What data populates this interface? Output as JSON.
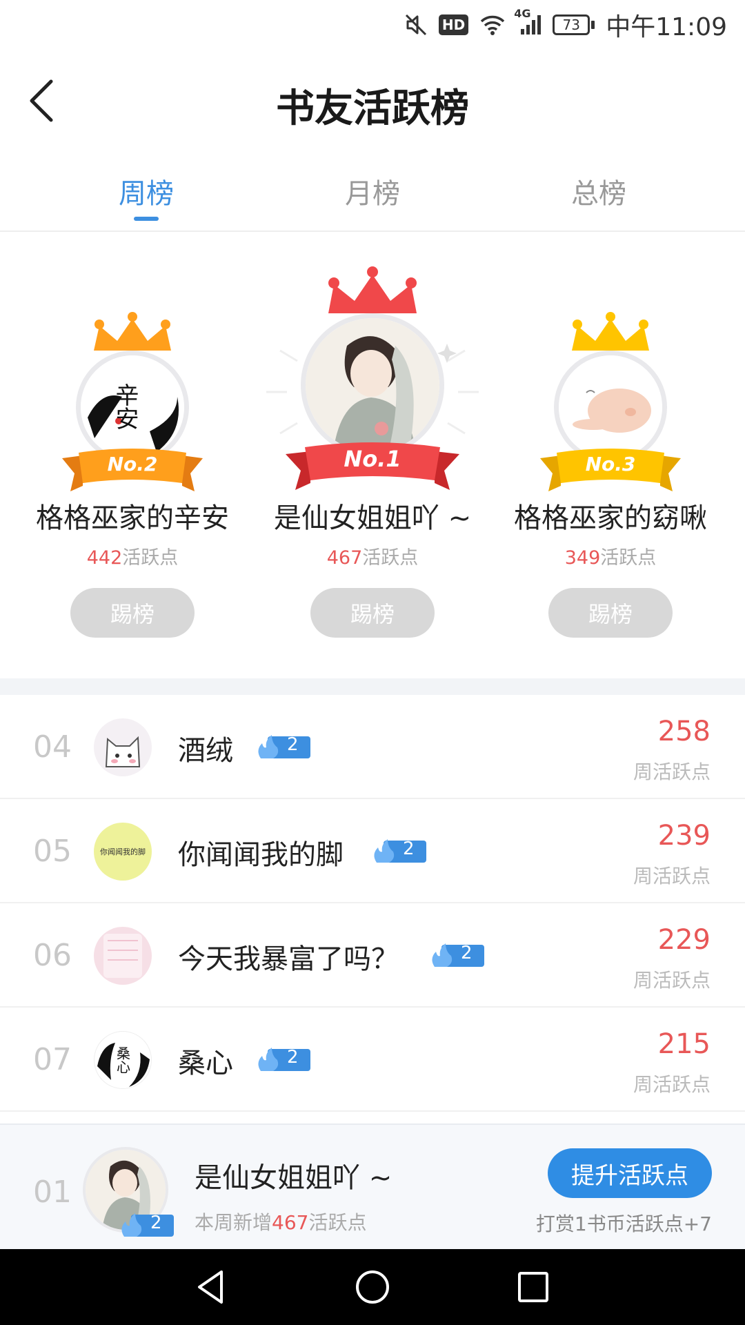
{
  "status_bar": {
    "time": "中午11:09",
    "battery": "73",
    "hd": "HD",
    "network": "4G"
  },
  "header": {
    "title": "书友活跃榜"
  },
  "tabs": [
    {
      "label": "周榜",
      "active": true
    },
    {
      "label": "月榜",
      "active": false
    },
    {
      "label": "总榜",
      "active": false
    }
  ],
  "podium": {
    "points_unit": "活跃点",
    "kick_label": "踢榜",
    "first": {
      "rank_label": "No.1",
      "name": "是仙女姐姐吖 ~",
      "points": "467",
      "avatar_text": ""
    },
    "second": {
      "rank_label": "No.2",
      "name": "格格巫家的辛安",
      "points": "442",
      "avatar_text": "辛安"
    },
    "third": {
      "rank_label": "No.3",
      "name": "格格巫家的窈啾",
      "points": "349",
      "avatar_text": ""
    }
  },
  "list": {
    "score_label": "周活跃点",
    "rows": [
      {
        "rank": "04",
        "name": "酒绒",
        "level": "2",
        "score": "258",
        "avatar_text": "",
        "avatar_color": "#f4f0f4"
      },
      {
        "rank": "05",
        "name": "你闻闻我的脚",
        "level": "2",
        "score": "239",
        "avatar_text": "你闻闻我的脚",
        "avatar_color": "#eef29a"
      },
      {
        "rank": "06",
        "name": "今天我暴富了吗？",
        "level": "2",
        "score": "229",
        "avatar_text": "",
        "avatar_color": "#f6dfe6"
      },
      {
        "rank": "07",
        "name": "桑心",
        "level": "2",
        "score": "215",
        "avatar_text": "桑心",
        "avatar_color": "#ffffff"
      }
    ]
  },
  "my_rank": {
    "rank": "01",
    "name": "是仙女姐姐吖 ~",
    "level": "2",
    "sub_prefix": "本周新增",
    "sub_points": "467",
    "sub_suffix": "活跃点",
    "boost_label": "提升活跃点",
    "boost_note": "打赏1书币活跃点+7"
  },
  "colors": {
    "accent_blue": "#3d8fe0",
    "score_red": "#e85757",
    "crown_gold": "#ffb400",
    "crown_red": "#f0484a",
    "crown_orange": "#ff9f1c"
  }
}
